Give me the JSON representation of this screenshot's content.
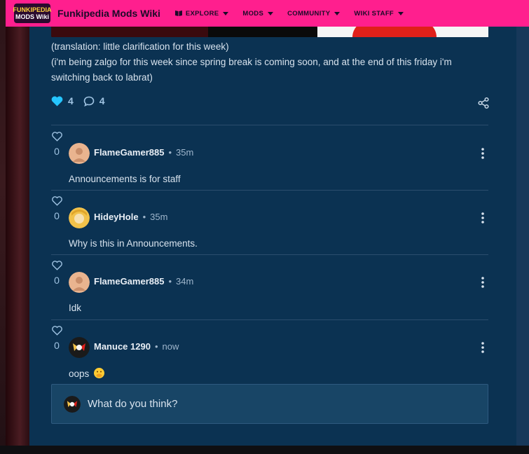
{
  "topnav": {
    "logo_line1": "FUNKIPEDIA",
    "logo_line2": "MODS Wiki",
    "wiki_title": "Funkipedia Mods Wiki",
    "items": [
      {
        "label": "EXPLORE",
        "icon": "book-icon"
      },
      {
        "label": "MODS"
      },
      {
        "label": "COMMUNITY"
      },
      {
        "label": "WIKI STAFF"
      }
    ]
  },
  "post": {
    "line1": "(translation: little clarification for this week)",
    "line2": "(i'm being zalgo for this week since spring break is coming soon, and at the end of this friday i'm switching back to labrat)",
    "likes": "4",
    "replies": "4"
  },
  "comments": [
    {
      "author": "FlameGamer885",
      "time": "35m",
      "text": "Announcements is for staff",
      "likes": "0",
      "avatar_color": "#e9b48f"
    },
    {
      "author": "HideyHole",
      "time": "35m",
      "text": "Why is this in Announcements.",
      "likes": "0",
      "avatar_color": "#f2c24a"
    },
    {
      "author": "FlameGamer885",
      "time": "34m",
      "text": "Idk",
      "likes": "0",
      "avatar_color": "#e9b48f"
    },
    {
      "author": "Manuce 1290",
      "time": "now",
      "text": "oops",
      "likes": "0",
      "avatar_color": "#1a1a1a"
    }
  ],
  "reply": {
    "placeholder": "What do you think?"
  },
  "colors": {
    "nav_bg": "#ff1f8e",
    "content_bg": "#0b3252",
    "accent_heart": "#25c5ff"
  }
}
